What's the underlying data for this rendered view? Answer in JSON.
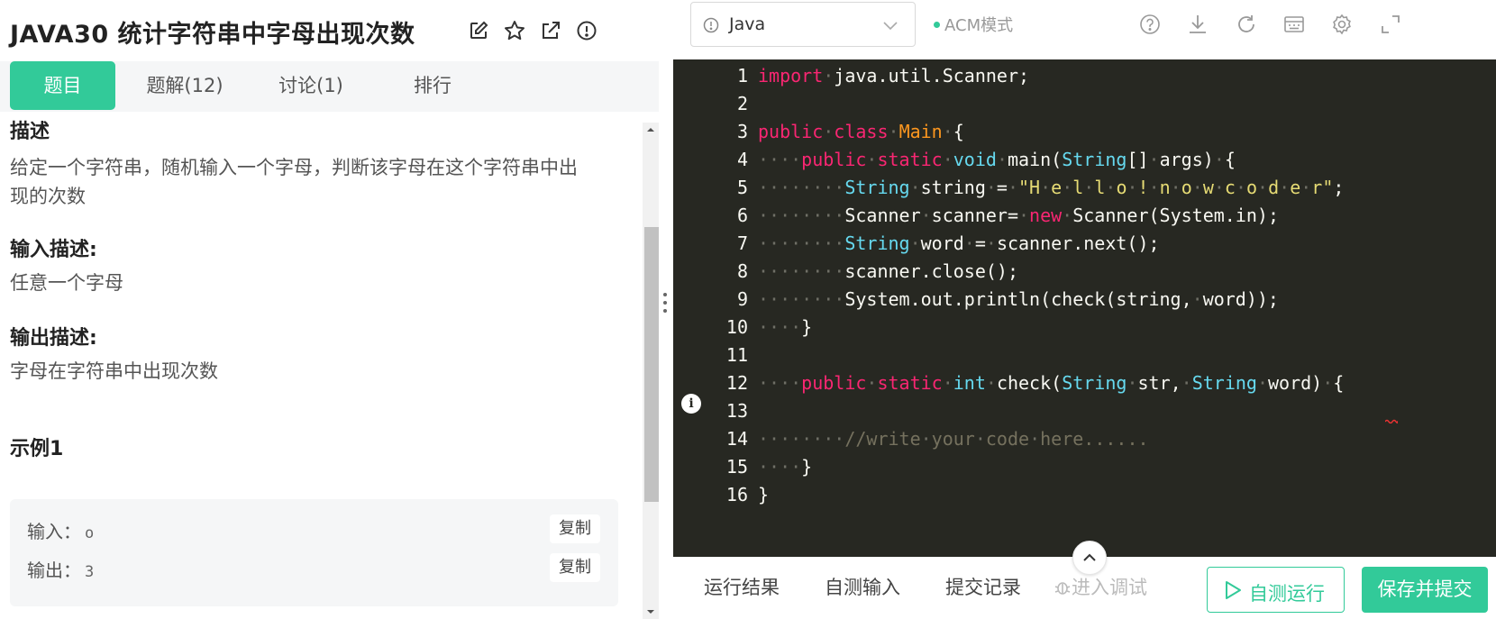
{
  "problem": {
    "title": "JAVA30  统计字符串中字母出现次数"
  },
  "title_icons": [
    "edit-icon",
    "star-icon",
    "external-link-icon",
    "info-icon"
  ],
  "tabs": [
    {
      "label": "题目",
      "active": true
    },
    {
      "label": "题解(12)",
      "active": false
    },
    {
      "label": "讨论(1)",
      "active": false
    },
    {
      "label": "排行",
      "active": false
    }
  ],
  "description": {
    "heading": "描述",
    "text_line1": "给定一个字符串，随机输入一个字母，判断该字母在这个字符串中出",
    "text_line2": "现的次数"
  },
  "input_desc": {
    "heading": "输入描述:",
    "text": "任意一个字母"
  },
  "output_desc": {
    "heading": "输出描述:",
    "text": "字母在字符串中出现次数"
  },
  "example": {
    "heading": "示例1",
    "input_label": "输入：",
    "input_value": "o",
    "output_label": "输出：",
    "output_value": "3",
    "copy_label": "复制"
  },
  "toolbar": {
    "language": "Java",
    "mode": "ACM模式",
    "icons": [
      "help-icon",
      "download-icon",
      "reset-icon",
      "keyboard-icon",
      "settings-icon",
      "fullscreen-icon"
    ]
  },
  "code_lines": [
    "1",
    "2",
    "3",
    "4",
    "5",
    "6",
    "7",
    "8",
    "9",
    "10",
    "11",
    "12",
    "13",
    "14",
    "15",
    "16"
  ],
  "bottom": {
    "tab_result": "运行结果",
    "tab_custom_input": "自测输入",
    "tab_history": "提交记录",
    "tab_debug": "进入调试",
    "run_label": "自测运行",
    "submit_label": "保存并提交"
  },
  "colors": {
    "accent": "#32ca99",
    "editor_bg": "#272822",
    "keyword": "#f92672",
    "type": "#66d9ef",
    "class": "#fd971f",
    "string": "#e6db74",
    "comment": "#75715e"
  }
}
